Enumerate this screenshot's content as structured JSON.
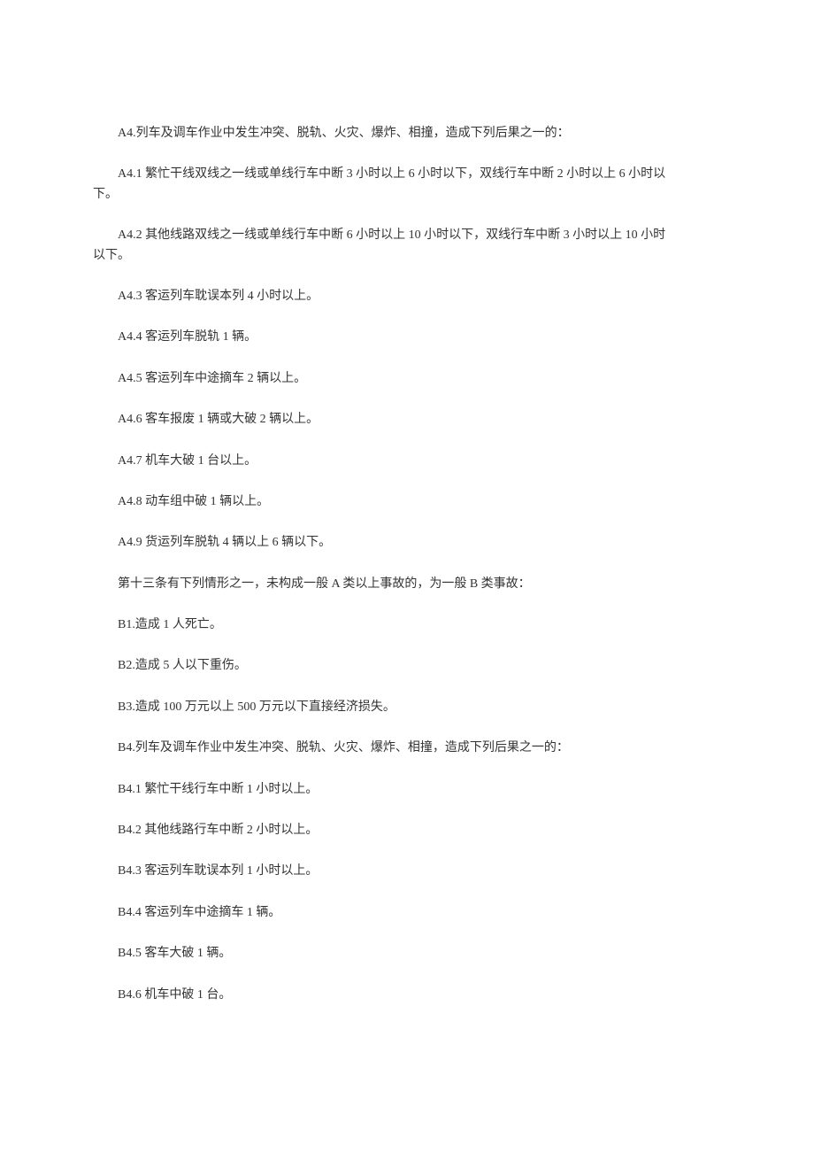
{
  "paragraphs": [
    {
      "text": "A4.列车及调车作业中发生冲突、脱轨、火灾、爆炸、相撞，造成下列后果之一的："
    },
    {
      "text": "A4.1 繁忙干线双线之一线或单线行车中断 3 小时以上 6 小时以下，双线行车中断 2 小时以上 6 小时以",
      "continue": "下。"
    },
    {
      "text": "A4.2 其他线路双线之一线或单线行车中断 6 小时以上 10 小时以下，双线行车中断 3 小时以上 10 小时",
      "continue": "以下。"
    },
    {
      "text": "A4.3 客运列车耽误本列 4 小时以上。"
    },
    {
      "text": "A4.4 客运列车脱轨 1 辆。"
    },
    {
      "text": "A4.5 客运列车中途摘车 2 辆以上。"
    },
    {
      "text": "A4.6 客车报废 1 辆或大破 2 辆以上。"
    },
    {
      "text": "A4.7 机车大破 1 台以上。"
    },
    {
      "text": "A4.8 动车组中破 1 辆以上。"
    },
    {
      "text": "A4.9 货运列车脱轨 4 辆以上 6 辆以下。"
    },
    {
      "text": "第十三条有下列情形之一，未构成一般 A 类以上事故的，为一般 B 类事故："
    },
    {
      "text": "B1.造成 1 人死亡。"
    },
    {
      "text": "B2.造成 5 人以下重伤。"
    },
    {
      "text": "B3.造成 100 万元以上 500 万元以下直接经济损失。"
    },
    {
      "text": "B4.列车及调车作业中发生冲突、脱轨、火灾、爆炸、相撞，造成下列后果之一的："
    },
    {
      "text": "B4.1 繁忙干线行车中断 1 小时以上。"
    },
    {
      "text": "B4.2 其他线路行车中断 2 小时以上。"
    },
    {
      "text": "B4.3 客运列车耽误本列 1 小时以上。"
    },
    {
      "text": "B4.4 客运列车中途摘车 1 辆。"
    },
    {
      "text": "B4.5 客车大破 1 辆。"
    },
    {
      "text": "B4.6 机车中破 1 台。"
    }
  ]
}
